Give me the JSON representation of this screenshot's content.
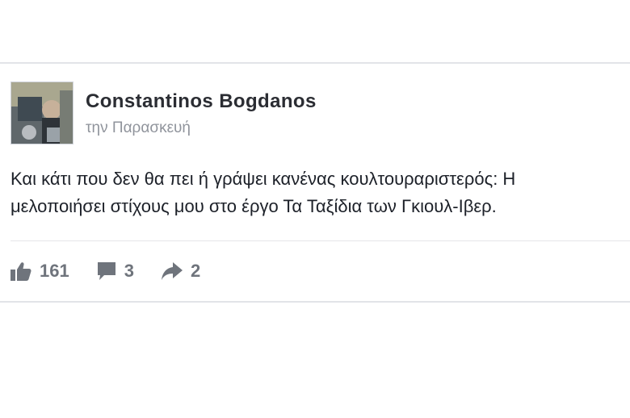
{
  "post": {
    "author": "Constantinos Bogdanos",
    "timestamp": "την Παρασκευή",
    "body_lines": [
      "Και κάτι που δεν θα πει ή γράψει κανένας κουλτουραριστερός: Η",
      "μελοποιήσει στίχους μου στο έργο Τα Ταξίδια των Γκιουλ-Ιβερ."
    ],
    "reactions": {
      "likes": "161",
      "comments": "3",
      "shares": "2"
    }
  },
  "icons": {
    "like": "thumbs-up-icon",
    "comment": "speech-bubble-icon",
    "share": "share-arrow-icon"
  },
  "colors": {
    "text": "#1d2129",
    "meta": "#90949c",
    "icon": "#6f747c",
    "border": "#e2e4e8"
  }
}
